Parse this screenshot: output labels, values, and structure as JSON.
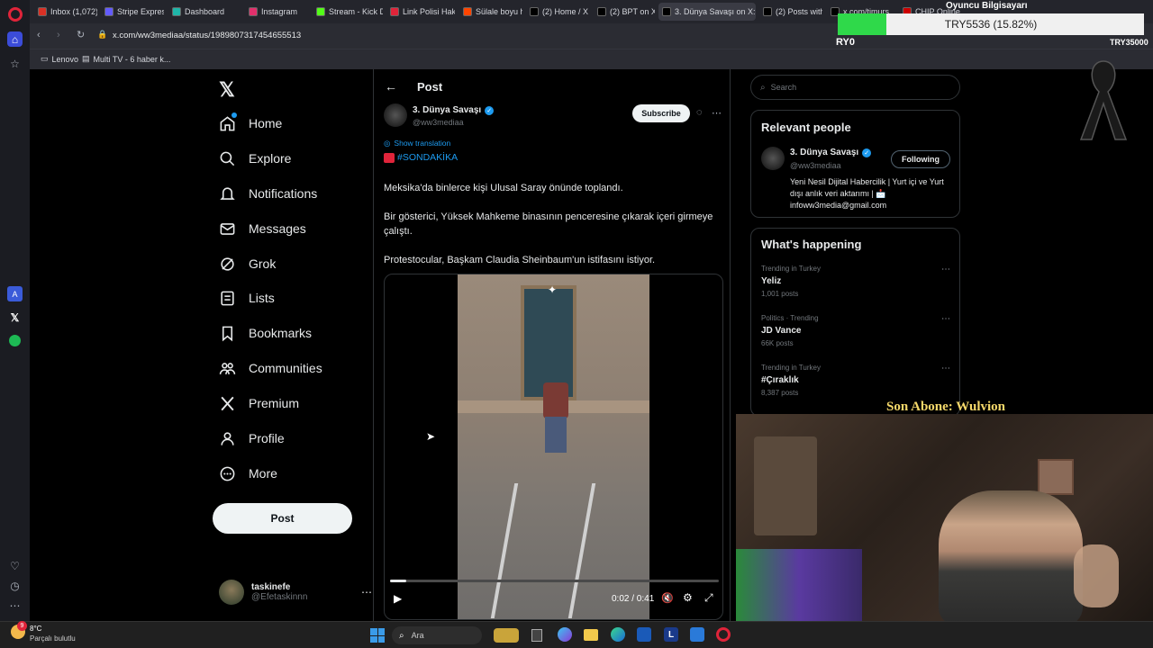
{
  "browser": {
    "tabs": [
      {
        "label": "Inbox (1,072) -",
        "color": "#d93025"
      },
      {
        "label": "Stripe Express",
        "color": "#635bff"
      },
      {
        "label": "Dashboard",
        "color": "#1fb5a8"
      },
      {
        "label": "Instagram",
        "color": "#e1306c"
      },
      {
        "label": "Stream - Kick D",
        "color": "#53fc18"
      },
      {
        "label": "Link Polisi Hak",
        "color": "#e0243a"
      },
      {
        "label": "Sülale boyu ha",
        "color": "#ff4500"
      },
      {
        "label": "(2) Home / X",
        "color": "#000000"
      },
      {
        "label": "(2) BPT on X: \"",
        "color": "#000000"
      },
      {
        "label": "3. Dünya Savaşı on X: \"",
        "color": "#000000"
      },
      {
        "label": "(2) Posts with n",
        "color": "#000000"
      },
      {
        "label": "x.com/timurs",
        "color": "#000000"
      },
      {
        "label": "CHIP Online",
        "color": "#cc0000"
      }
    ],
    "url": "x.com/ww3mediaa/status/1989807317454655513",
    "bookmarks": [
      "Lenovo",
      "Multi TV - 6 haber k..."
    ]
  },
  "nav": {
    "items": [
      {
        "label": "Home",
        "icon": "home-icon"
      },
      {
        "label": "Explore",
        "icon": "search-icon"
      },
      {
        "label": "Notifications",
        "icon": "bell-icon"
      },
      {
        "label": "Messages",
        "icon": "envelope-icon"
      },
      {
        "label": "Grok",
        "icon": "grok-icon"
      },
      {
        "label": "Lists",
        "icon": "list-icon"
      },
      {
        "label": "Bookmarks",
        "icon": "bookmark-icon"
      },
      {
        "label": "Communities",
        "icon": "people-icon"
      },
      {
        "label": "Premium",
        "icon": "x-icon"
      },
      {
        "label": "Profile",
        "icon": "person-icon"
      },
      {
        "label": "More",
        "icon": "more-circle-icon"
      }
    ],
    "post_button": "Post",
    "account": {
      "name": "taskinefe",
      "handle": "@Efetaskinnn"
    }
  },
  "post": {
    "header": "Post",
    "author": {
      "name": "3. Dünya Savaşı",
      "handle": "@ww3mediaa"
    },
    "subscribe": "Subscribe",
    "show_translation": "Show translation",
    "hashtag": "#SONDAKİKA",
    "paragraphs": [
      "Meksika'da binlerce kişi Ulusal Saray önünde toplandı.",
      "Bir gösterici, Yüksek Mahkeme binasının penceresine çıkarak içeri girmeye çalıştı.",
      "Protestocular, Başkam Claudia Sheinbaum'un istifasını istiyor."
    ],
    "video": {
      "time": "0:02 / 0:41",
      "progress": 0.05
    }
  },
  "sidebar": {
    "search_placeholder": "Search",
    "relevant_title": "Relevant people",
    "relevant_person": {
      "name": "3. Dünya Savaşı",
      "handle": "@ww3mediaa",
      "button": "Following",
      "bio": "Yeni Nesil Dijital Habercilik | Yurt içi ve Yurt dışı anlık veri aktarımı | 📩 infoww3media@gmail.com"
    },
    "happening_title": "What's happening",
    "trends": [
      {
        "category": "Trending in Turkey",
        "name": "Yeliz",
        "count": "1,001 posts"
      },
      {
        "category": "Politics · Trending",
        "name": "JD Vance",
        "count": "66K posts"
      },
      {
        "category": "Trending in Turkey",
        "name": "#Çıraklık",
        "count": "8,387 posts"
      }
    ]
  },
  "overlay": {
    "title": "Oyuncu Bilgisayarı",
    "goal": "TRY5536 (15.82%)",
    "goal_fraction": 0.158,
    "goal_left": "RY0",
    "goal_right": "TRY35000",
    "subscriber": "Son Abone: Wulvion"
  },
  "taskbar": {
    "temp": "8°C",
    "weather": "Parçalı bulutlu",
    "search": "Ara",
    "badge": "9"
  },
  "colors": {
    "accent": "#1d9bf0",
    "verified": "#1d9bf0",
    "goal": "#2fd94a"
  }
}
